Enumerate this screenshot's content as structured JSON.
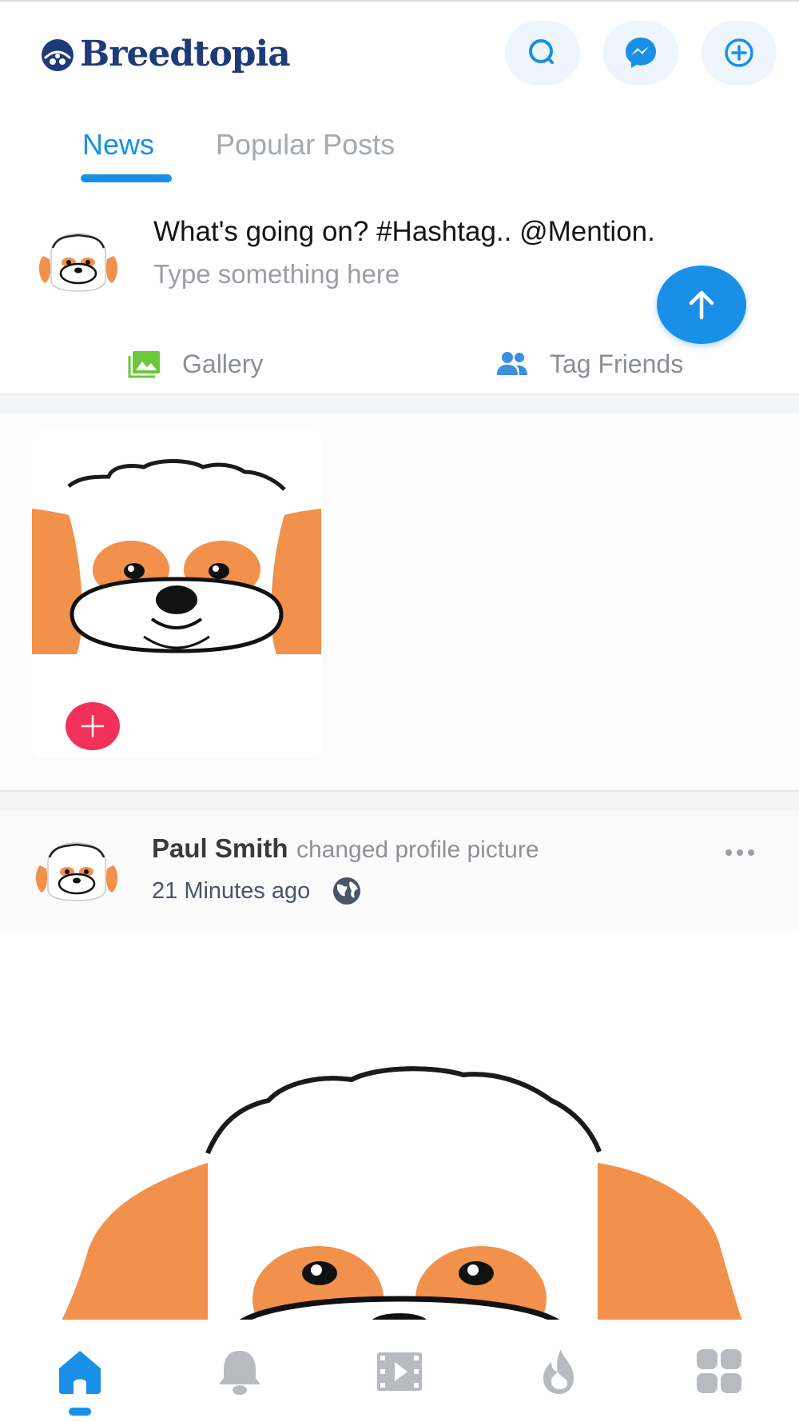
{
  "app": {
    "name": "Breedtopia",
    "logo_icon": "paw-globe-logo",
    "accent_color": "#1a8fe8",
    "brand_color": "#1f3a78"
  },
  "header": {
    "buttons": [
      {
        "icon": "search-icon"
      },
      {
        "icon": "messenger-icon"
      },
      {
        "icon": "add-circle-icon"
      }
    ]
  },
  "tabs": [
    {
      "label": "News",
      "active": true
    },
    {
      "label": "Popular Posts",
      "active": false
    }
  ],
  "composer": {
    "prompt": "What's going on? #Hashtag.. @Mention.",
    "placeholder": "Type something here",
    "actions": [
      {
        "label": "Gallery",
        "icon": "gallery-icon",
        "color": "#6cc93a"
      },
      {
        "label": "Tag Friends",
        "icon": "people-icon",
        "color": "#3b8ee0"
      }
    ],
    "post_button_icon": "arrow-up-icon"
  },
  "story": {
    "add_icon": "plus-icon",
    "add_color": "#f2315a"
  },
  "post": {
    "author": "Paul Smith",
    "action": "changed profile picture",
    "time": "21 Minutes ago",
    "privacy_icon": "globe-icon",
    "menu_icon": "more-dots-icon"
  },
  "bottom_nav": [
    {
      "icon": "home-icon",
      "active": true
    },
    {
      "icon": "bell-icon",
      "active": false
    },
    {
      "icon": "video-icon",
      "active": false
    },
    {
      "icon": "fire-icon",
      "active": false
    },
    {
      "icon": "grid-icon",
      "active": false
    }
  ]
}
